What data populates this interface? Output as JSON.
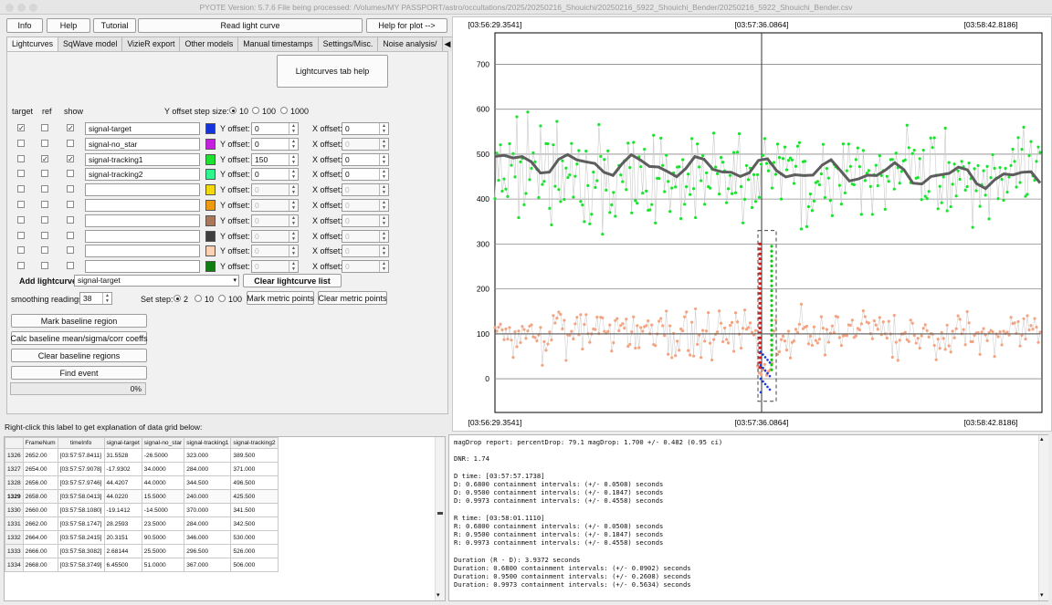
{
  "window": {
    "title": "PYOTE Version: 5.7.6  File being processed: /Volumes/MY PASSPORT/astro/occultations/2025/20250216_Shouichi/20250216_5922_Shouichi_Bender/20250216_5922_Shouichi_Bender.csv"
  },
  "toolbar": {
    "info": "Info",
    "help": "Help",
    "tutorial": "Tutorial",
    "read_lc": "Read light curve",
    "help_plot": "Help for plot -->"
  },
  "tabs": [
    "Lightcurves",
    "SqWave model",
    "VizieR export",
    "Other models",
    "Manual timestamps",
    "Settings/Misc.",
    "Noise analysis/"
  ],
  "lc": {
    "help_button": "Lightcurves tab help",
    "col_target": "target",
    "col_ref": "ref",
    "col_show": "show",
    "y_step_label": "Y offset step size:",
    "y_steps": [
      "10",
      "100",
      "1000"
    ],
    "yoffset_label": "Y offset:",
    "xoffset_label": "X offset:",
    "rows": [
      {
        "target": "✓",
        "ref": "",
        "show": "✓",
        "name": "signal-target",
        "color": "#1433dd",
        "y": "0",
        "x": "0"
      },
      {
        "target": "",
        "ref": "",
        "show": "",
        "name": "signal-no_star",
        "color": "#c41fe0",
        "y": "0",
        "x": "0"
      },
      {
        "target": "",
        "ref": "✓",
        "show": "✓",
        "name": "signal-tracking1",
        "color": "#1ee030",
        "y": "150",
        "x": "0"
      },
      {
        "target": "",
        "ref": "",
        "show": "",
        "name": "signal-tracking2",
        "color": "#2ef58e",
        "y": "0",
        "x": "0"
      },
      {
        "target": "",
        "ref": "",
        "show": "",
        "name": "",
        "color": "#f3d90c",
        "y": "0",
        "x": "0"
      },
      {
        "target": "",
        "ref": "",
        "show": "",
        "name": "",
        "color": "#ee9a10",
        "y": "0",
        "x": "0"
      },
      {
        "target": "",
        "ref": "",
        "show": "",
        "name": "",
        "color": "#a9785d",
        "y": "0",
        "x": "0"
      },
      {
        "target": "",
        "ref": "",
        "show": "",
        "name": "",
        "color": "#3f3f3f",
        "y": "0",
        "x": "0"
      },
      {
        "target": "",
        "ref": "",
        "show": "",
        "name": "",
        "color": "#fdd1b4",
        "y": "0",
        "x": "0"
      },
      {
        "target": "",
        "ref": "",
        "show": "",
        "name": "",
        "color": "#0f7d10",
        "y": "0",
        "x": "0"
      }
    ],
    "add_lc_label": "Add lightcurve",
    "add_lc_value": "signal-target",
    "clear_list": "Clear lightcurve list",
    "smoothing_label": "smoothing readings",
    "smoothing_value": "38",
    "set_step_label": "Set step:",
    "steps": [
      "2",
      "10",
      "100"
    ],
    "mark_metric": "Mark metric points",
    "clear_metric": "Clear metric points",
    "mark_baseline": "Mark baseline region",
    "calc_baseline": "Calc baseline mean/sigma/corr coeffs",
    "clear_baseline": "Clear baseline regions",
    "find_event": "Find event",
    "progress": "0%"
  },
  "grid_hint": "Right-click this label to get explanation of data grid below:",
  "grid": {
    "headers": [
      "FrameNum",
      "timeInfo",
      "signal-target",
      "signal-no_star",
      "signal-tracking1",
      "signal-tracking2"
    ],
    "rows": [
      [
        "1326",
        "2652.00",
        "[03:57:57.8411]",
        "31.5528",
        "-26.5000",
        "323.000",
        "389.500"
      ],
      [
        "1327",
        "2654.00",
        "[03:57:57.9078]",
        "-17.9302",
        "34.0000",
        "284.000",
        "371.000"
      ],
      [
        "1328",
        "2656.00",
        "[03:57:57.9746]",
        "44.4207",
        "44.0000",
        "344.500",
        "496.500"
      ],
      [
        "1329",
        "2658.00",
        "[03:57:58.0413]",
        "44.0220",
        "15.5000",
        "240.000",
        "425.500"
      ],
      [
        "1330",
        "2660.00",
        "[03:57:58.1080]",
        "-19.1412",
        "-14.5000",
        "370.000",
        "341.500"
      ],
      [
        "1331",
        "2662.00",
        "[03:57:58.1747]",
        "28.2593",
        "23.5000",
        "284.000",
        "342.500"
      ],
      [
        "1332",
        "2664.00",
        "[03:57:58.2415]",
        "20.3151",
        "90.5000",
        "346.000",
        "530.000"
      ],
      [
        "1333",
        "2666.00",
        "[03:57:58.3082]",
        "2.68144",
        "25.5000",
        "296.500",
        "526.000"
      ],
      [
        "1334",
        "2668.00",
        "[03:57:58.3749]",
        "6.45500",
        "51.0000",
        "367.000",
        "506.000"
      ]
    ]
  },
  "report": [
    "magDrop report: percentDrop: 79.1 magDrop: 1.700 +/- 0.482 (0.95 ci)",
    "",
    "DNR: 1.74",
    "",
    "D time: [03:57:57.1738]",
    "D: 0.6800 containment intervals: (+/- 0.0508) seconds",
    "D: 0.9500 containment intervals: (+/- 0.1847) seconds",
    "D: 0.9973 containment intervals: (+/- 0.4558) seconds",
    "",
    "R time: [03:58:01.1110]",
    "R: 0.6800 containment intervals: (+/- 0.0508) seconds",
    "R: 0.9500 containment intervals: (+/- 0.1847) seconds",
    "R: 0.9973 containment intervals: (+/- 0.4558) seconds",
    "",
    "Duration (R - D): 3.9372 seconds",
    "Duration: 0.6800 containment intervals: (+/- 0.0902) seconds",
    "Duration: 0.9500 containment intervals: (+/- 0.2608) seconds",
    "Duration: 0.9973 containment intervals: (+/- 0.5634) seconds"
  ],
  "chart_data": {
    "type": "scatter",
    "x_ticks": [
      "[03:56:29.3541]",
      "[03:57:36.0864]",
      "[03:58:42.8186]"
    ],
    "y_ticks": [
      "0",
      "100",
      "200",
      "300",
      "400",
      "500",
      "600",
      "700"
    ],
    "ylim": [
      -75,
      770
    ],
    "grid": true,
    "series": [
      {
        "name": "signal-tracking1",
        "color": "#1ee030",
        "mean": 450,
        "spread": 95
      },
      {
        "name": "signal-target",
        "color": "#f0a585",
        "mean": 100,
        "spread": 45
      },
      {
        "name": "smoothed",
        "color": "#606060"
      }
    ],
    "event": {
      "d_marker": "[03:57:57.1738]",
      "r_marker": "[03:58:01.1110]"
    }
  }
}
